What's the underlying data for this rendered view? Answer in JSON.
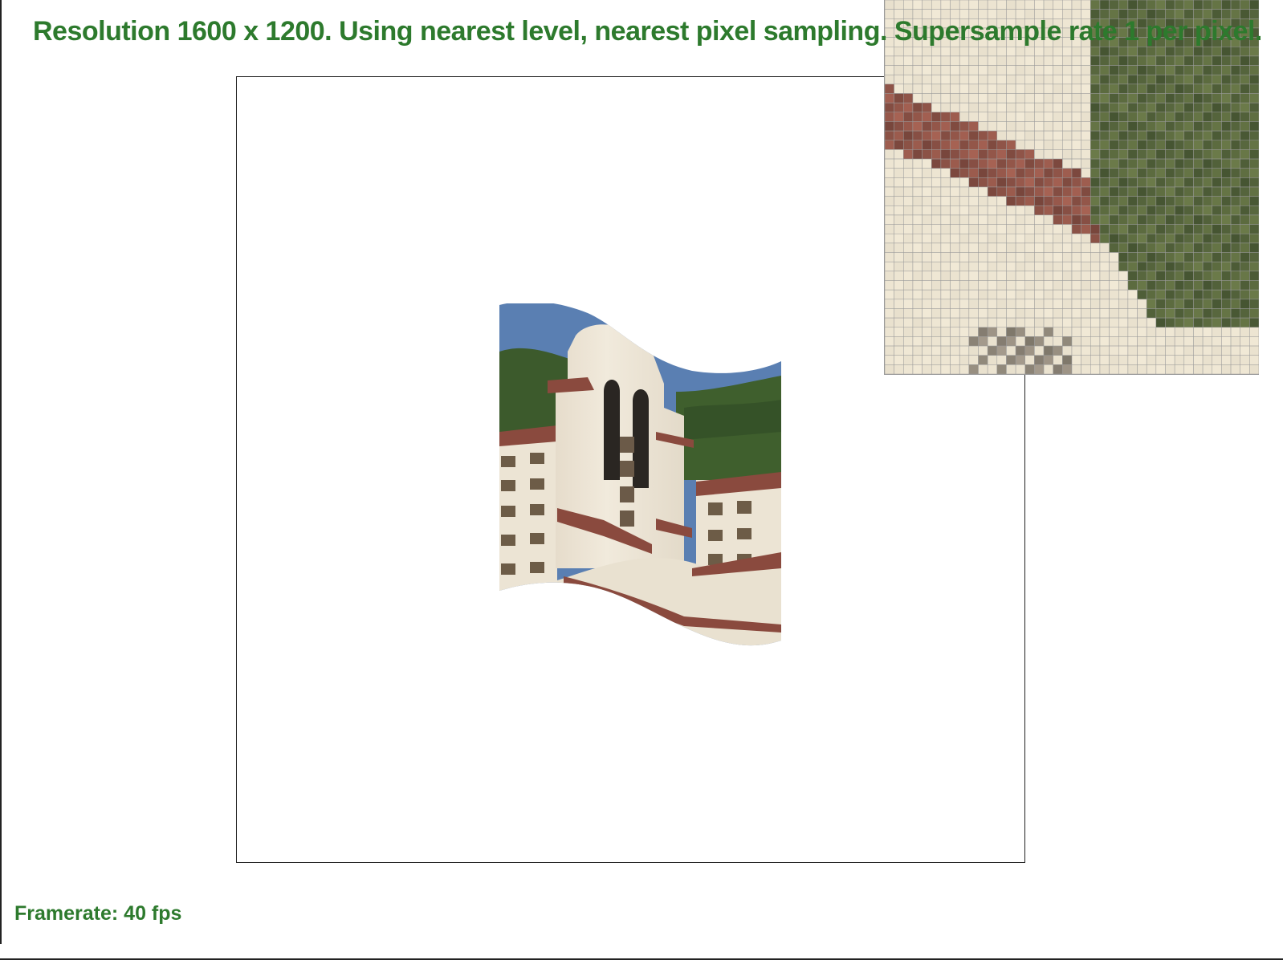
{
  "status": {
    "resolution_text": "Resolution 1600 x 1200. Using nearest level, nearest pixel sampling. Supersample rate 1 per pixel.",
    "framerate_text": "Framerate: 40 fps"
  },
  "colors": {
    "status_text": "#2d7a2d",
    "viewport_border": "#222222",
    "sky": "#5a7fb2",
    "building": "#ece4d2",
    "roof": "#8a4a3e",
    "foliage": "#3c5a2c"
  },
  "zoom": {
    "grid": 40
  }
}
